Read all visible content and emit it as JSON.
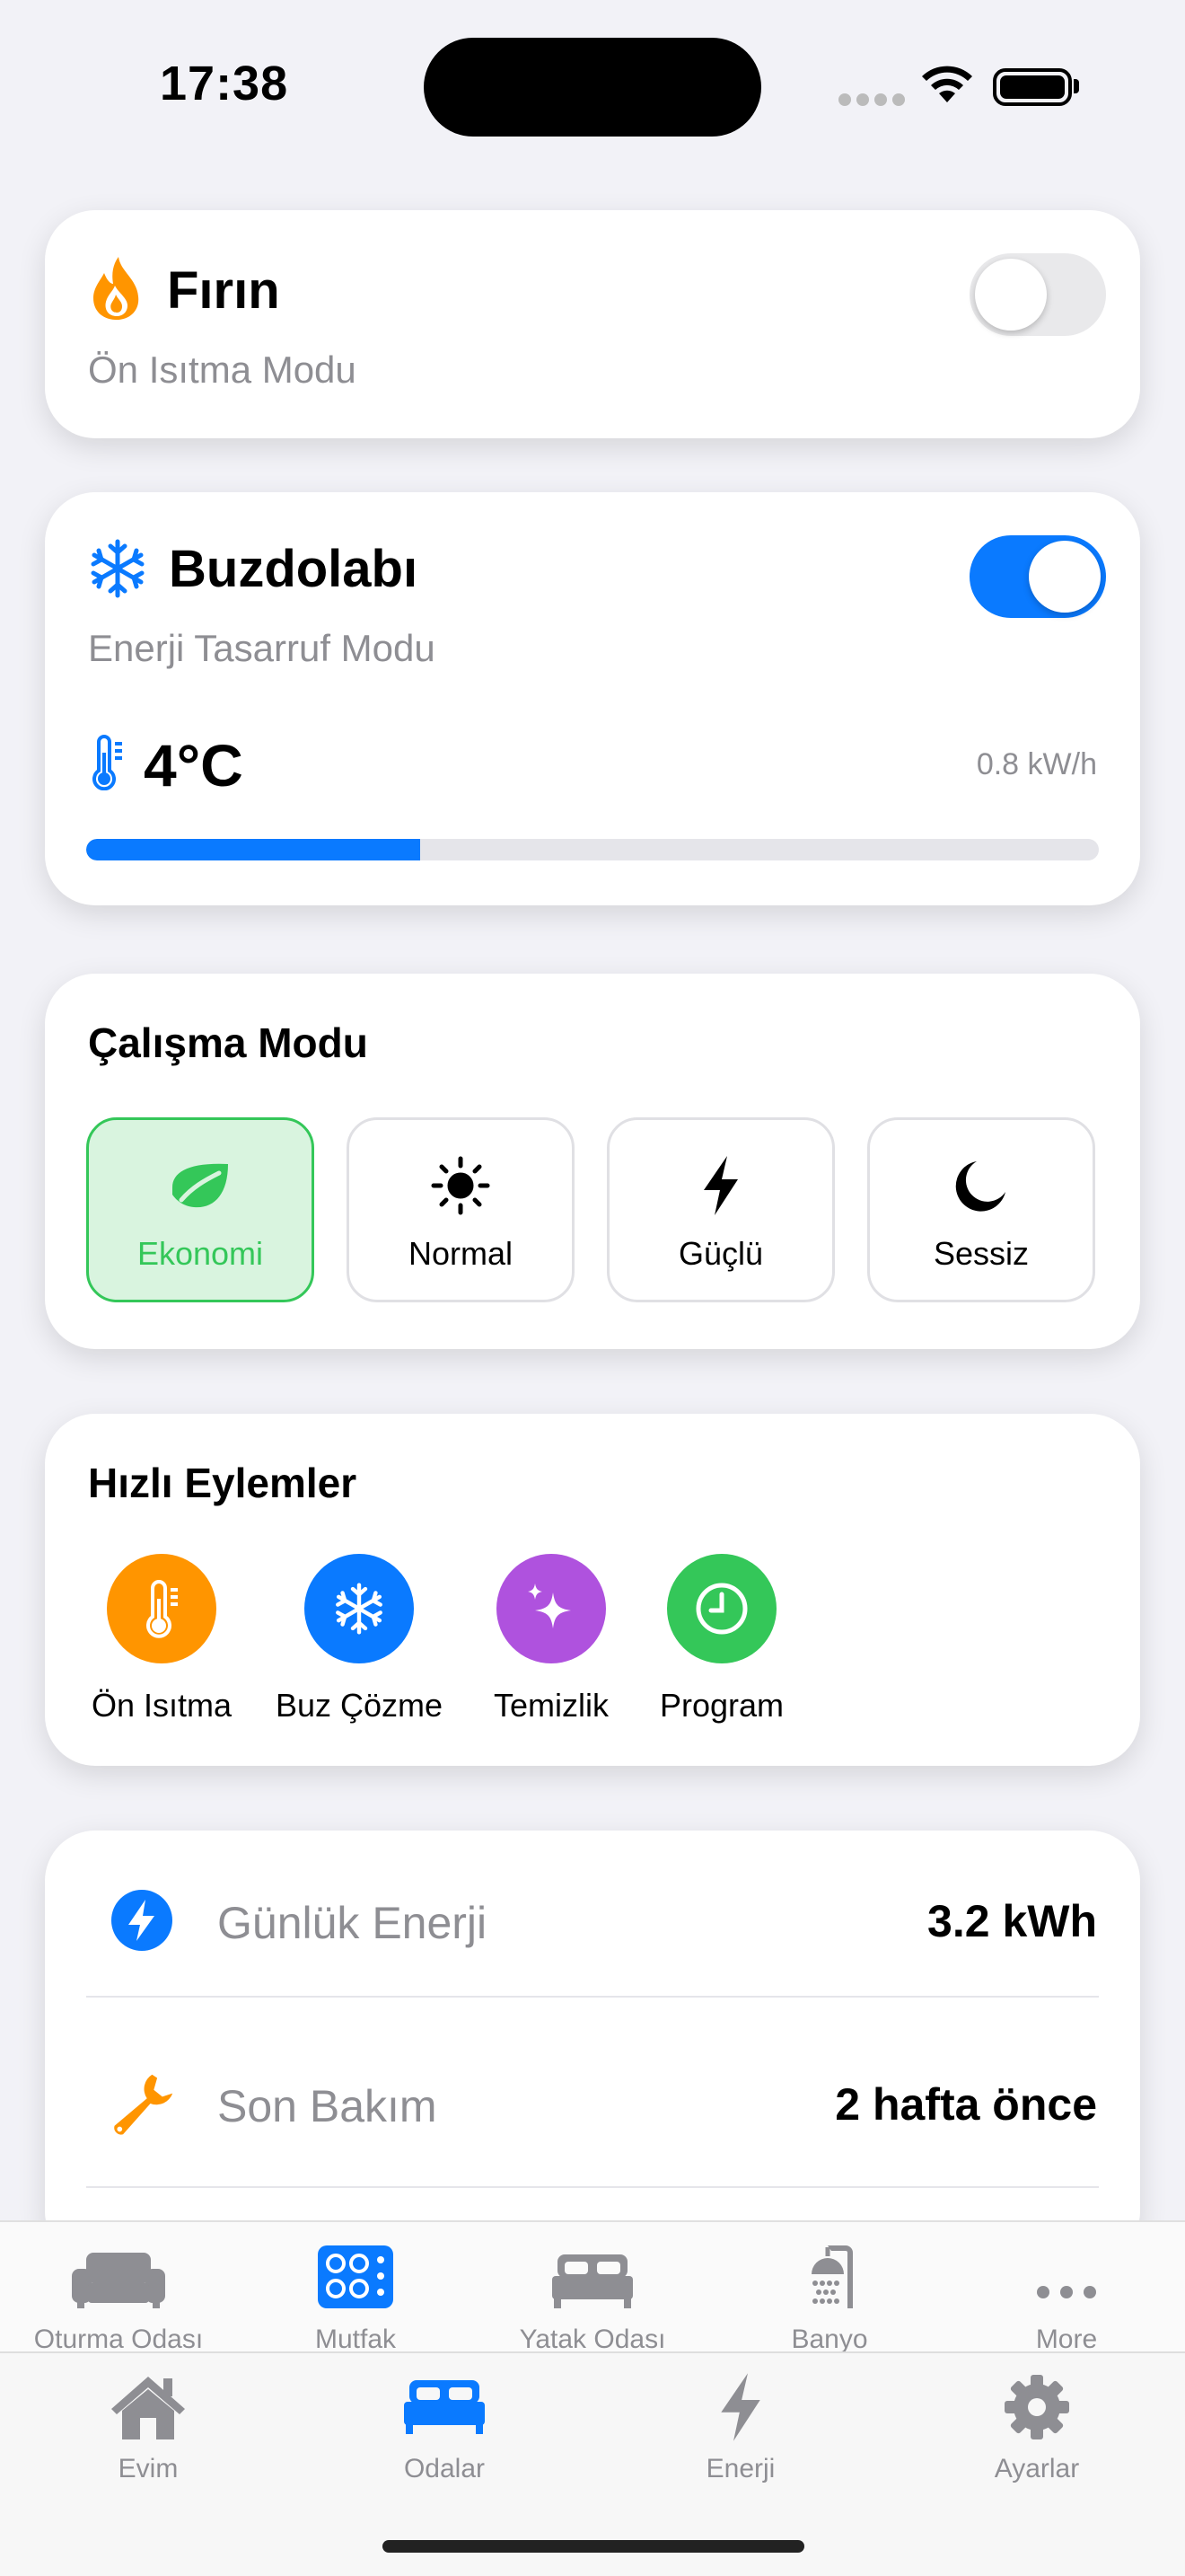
{
  "status_bar": {
    "time": "17:38"
  },
  "oven": {
    "title": "Fırın",
    "subtitle": "Ön Isıtma Modu",
    "icon": "flame-icon",
    "enabled": false
  },
  "fridge": {
    "title": "Buzdolabı",
    "subtitle": "Enerji Tasarruf Modu",
    "icon": "snowflake-icon",
    "enabled": true,
    "temperature": "4°C",
    "power": "0.8 kW/h",
    "level_fraction": 0.33
  },
  "operation_mode": {
    "title": "Çalışma Modu",
    "modes": [
      {
        "label": "Ekonomi",
        "icon": "leaf-icon",
        "selected": true
      },
      {
        "label": "Normal",
        "icon": "sun-icon",
        "selected": false
      },
      {
        "label": "Güçlü",
        "icon": "bolt-icon",
        "selected": false
      },
      {
        "label": "Sessiz",
        "icon": "moon-icon",
        "selected": false
      }
    ]
  },
  "quick_actions": {
    "title": "Hızlı Eylemler",
    "items": [
      {
        "label": "Ön Isıtma",
        "icon": "thermometer-icon",
        "color": "#ff9500"
      },
      {
        "label": "Buz Çözme",
        "icon": "snowflake-icon",
        "color": "#0a7aff"
      },
      {
        "label": "Temizlik",
        "icon": "sparkles-icon",
        "color": "#af52de"
      },
      {
        "label": "Program",
        "icon": "clock-icon",
        "color": "#34c759"
      }
    ]
  },
  "info": {
    "rows": [
      {
        "label": "Günlük Enerji",
        "value": "3.2 kWh",
        "icon": "bolt-circle-icon"
      },
      {
        "label": "Son Bakım",
        "value": "2 hafta önce",
        "icon": "wrench-icon"
      }
    ]
  },
  "room_tabs": [
    {
      "label": "Oturma Odası",
      "icon": "sofa-icon",
      "active": false
    },
    {
      "label": "Mutfak",
      "icon": "stove-icon",
      "active": true
    },
    {
      "label": "Yatak Odası",
      "icon": "bed-icon",
      "active": false
    },
    {
      "label": "Banyo",
      "icon": "shower-icon",
      "active": false
    },
    {
      "label": "More",
      "icon": "more-icon",
      "active": false
    }
  ],
  "main_tabs": [
    {
      "label": "Evim",
      "icon": "house-icon",
      "active": false
    },
    {
      "label": "Odalar",
      "icon": "bed-icon",
      "active": true
    },
    {
      "label": "Enerji",
      "icon": "bolt-icon",
      "active": false
    },
    {
      "label": "Ayarlar",
      "icon": "gear-icon",
      "active": false
    }
  ],
  "colors": {
    "accent": "#0a7aff",
    "green": "#34c759",
    "orange": "#ff9500",
    "purple": "#af52de",
    "background": "#f2f2f7"
  }
}
